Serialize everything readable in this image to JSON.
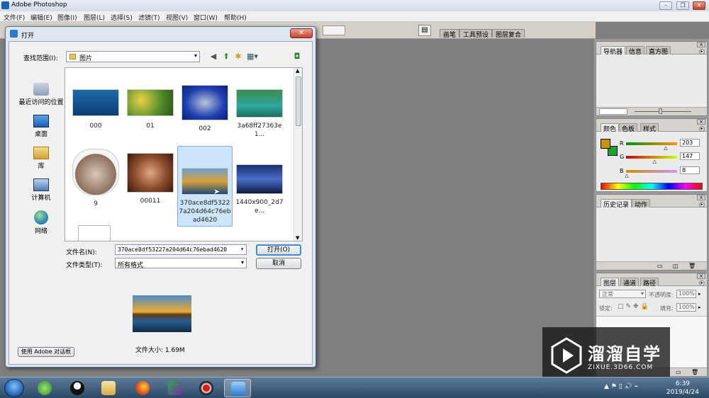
{
  "app": {
    "title": "Adobe Photoshop",
    "menu": [
      "文件(F)",
      "编辑(E)",
      "图像(I)",
      "图层(L)",
      "选择(S)",
      "滤镜(T)",
      "视图(V)",
      "窗口(W)",
      "帮助(H)"
    ],
    "option_tabs": [
      "画笔",
      "工具预设",
      "图层复合"
    ]
  },
  "panels": {
    "navigator": {
      "tabs": [
        "导航器",
        "信息",
        "直方图"
      ]
    },
    "color": {
      "tabs": [
        "颜色",
        "色板",
        "样式"
      ],
      "channels": [
        {
          "label": "R",
          "value": "203",
          "fraction": 0.796
        },
        {
          "label": "G",
          "value": "147",
          "fraction": 0.576
        },
        {
          "label": "B",
          "value": "8",
          "fraction": 0.031
        }
      ],
      "foreground": "#cb9308",
      "background": "#1aa32a"
    },
    "history": {
      "tabs": [
        "历史记录",
        "动作"
      ]
    },
    "layers": {
      "tabs": [
        "图层",
        "通道",
        "路径"
      ],
      "blend_mode": "正常",
      "opacity_label": "不透明度:",
      "opacity_value": "100%",
      "lock_label": "锁定:",
      "fill_label": "填充:",
      "fill_value": "100%"
    }
  },
  "dialog": {
    "title": "打开",
    "lookin_label": "查找范围(I):",
    "lookin_value": "图片",
    "places": [
      "最近访问的位置",
      "桌面",
      "库",
      "计算机",
      "网络"
    ],
    "files": [
      {
        "name": "000",
        "icon": "photo-thumb-woman-blue"
      },
      {
        "name": "01",
        "icon": "photo-thumb-flowers"
      },
      {
        "name": "002",
        "icon": "photo-thumb-fish"
      },
      {
        "name": "3a68ff27363e1...",
        "icon": "photo-thumb-lake"
      },
      {
        "name": "9",
        "icon": "photo-thumb-collage"
      },
      {
        "name": "00011",
        "icon": "photo-thumb-girl"
      },
      {
        "name": "370ace8df53227a204d64c76ebad4620",
        "icon": "photo-thumb-mountain",
        "selected": true
      },
      {
        "name": "1440x900_2d7e...",
        "icon": "photo-thumb-seascape"
      }
    ],
    "filename_label": "文件名(N):",
    "filename_value": "370ace8df53227a204d64c76ebad4620",
    "filetype_label": "文件类型(T):",
    "filetype_value": "所有格式",
    "open_button": "打开(O)",
    "cancel_button": "取消",
    "filesize": "文件大小: 1.69M",
    "use_adobe_button": "使用 Adobe 对话框"
  },
  "taskbar": {
    "time": "6:39",
    "date": "2019/4/24"
  },
  "watermark": {
    "title": "溜溜自学",
    "subtitle": "ZIXUE.3D66.COM"
  }
}
